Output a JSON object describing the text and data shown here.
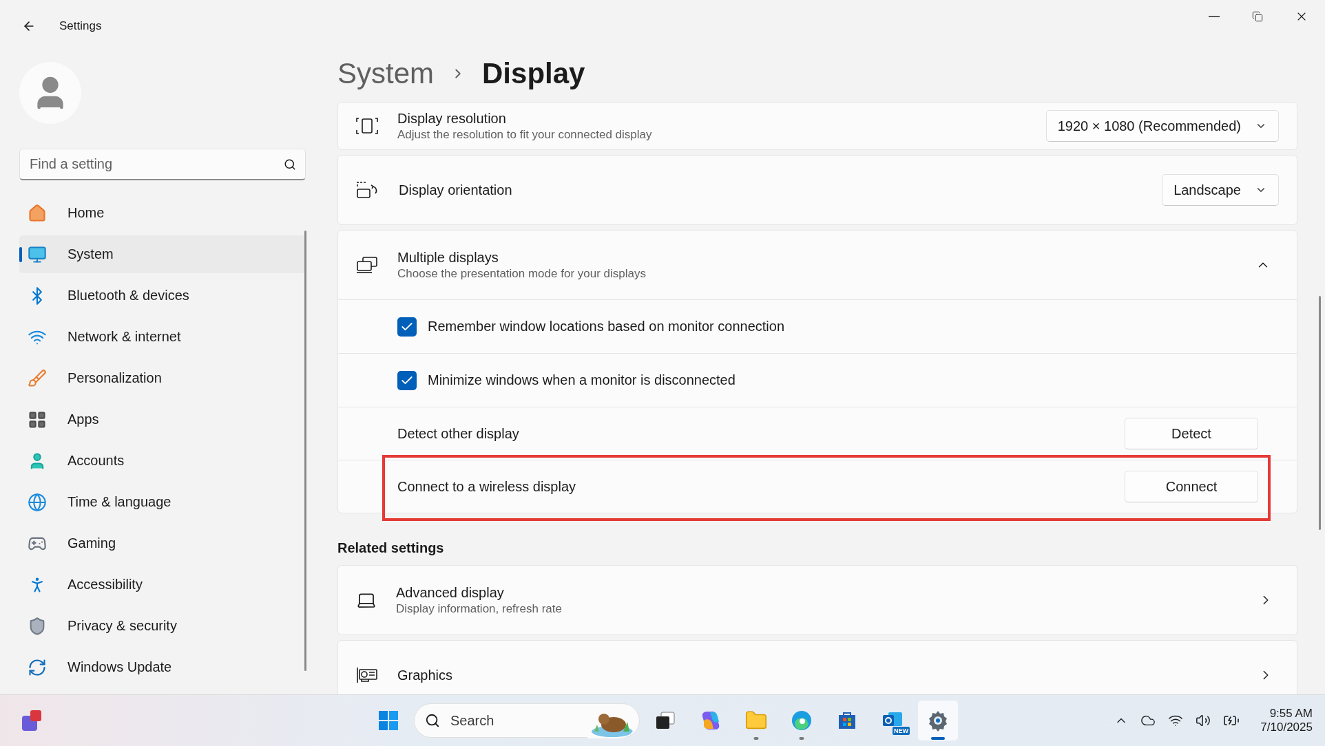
{
  "window": {
    "title": "Settings"
  },
  "sidebar": {
    "search": {
      "placeholder": "Find a setting"
    },
    "items": [
      {
        "label": "Home",
        "selected": false
      },
      {
        "label": "System",
        "selected": true
      },
      {
        "label": "Bluetooth & devices",
        "selected": false
      },
      {
        "label": "Network & internet",
        "selected": false
      },
      {
        "label": "Personalization",
        "selected": false
      },
      {
        "label": "Apps",
        "selected": false
      },
      {
        "label": "Accounts",
        "selected": false
      },
      {
        "label": "Time & language",
        "selected": false
      },
      {
        "label": "Gaming",
        "selected": false
      },
      {
        "label": "Accessibility",
        "selected": false
      },
      {
        "label": "Privacy & security",
        "selected": false
      },
      {
        "label": "Windows Update",
        "selected": false
      }
    ]
  },
  "breadcrumb": [
    "System",
    "Display"
  ],
  "settings": [
    {
      "kind": "dropdown",
      "title": "Display resolution",
      "subtitle": "Adjust the resolution to fit your connected display",
      "value": "1920 × 1080 (Recommended)"
    },
    {
      "kind": "dropdown",
      "title": "Display orientation",
      "value": "Landscape"
    },
    {
      "kind": "group",
      "title": "Multiple displays",
      "subtitle": "Choose the presentation mode for your displays",
      "expanded": true,
      "children": [
        {
          "kind": "checkbox",
          "label": "Remember window locations based on monitor connection",
          "checked": true
        },
        {
          "kind": "checkbox",
          "label": "Minimize windows when a monitor is disconnected",
          "checked": true
        },
        {
          "kind": "button",
          "label": "Detect other display",
          "button": "Detect",
          "highlighted": false
        },
        {
          "kind": "button",
          "label": "Connect to a wireless display",
          "button": "Connect",
          "highlighted": true
        }
      ]
    }
  ],
  "related": {
    "heading": "Related settings",
    "items": [
      {
        "title": "Advanced display",
        "subtitle": "Display information, refresh rate"
      },
      {
        "title": "Graphics"
      }
    ]
  },
  "taskbar": {
    "search": {
      "placeholder": "Search"
    },
    "apps": [
      {
        "running": false,
        "selected": false
      },
      {
        "running": false,
        "selected": false
      },
      {
        "running": true,
        "selected": false
      },
      {
        "running": true,
        "selected": false
      },
      {
        "running": false,
        "selected": false
      },
      {
        "running": false,
        "selected": false
      },
      {
        "running": true,
        "selected": true
      }
    ],
    "badge": "NEW",
    "time": "9:55 AM",
    "date": "7/10/2025"
  }
}
